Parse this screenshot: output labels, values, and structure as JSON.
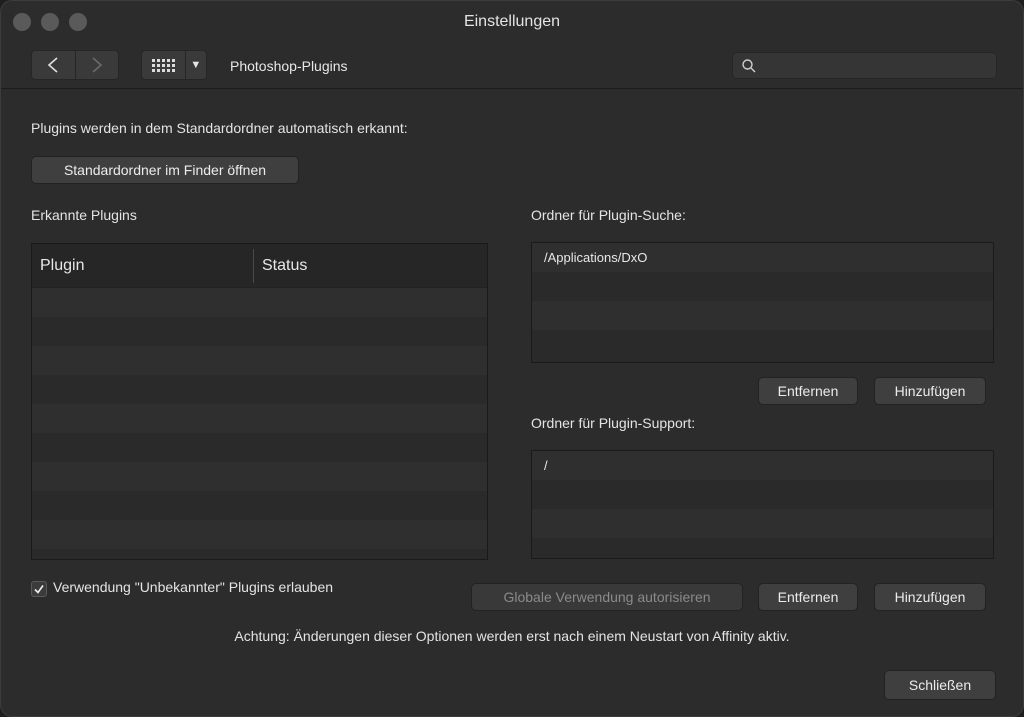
{
  "window": {
    "title": "Einstellungen"
  },
  "toolbar": {
    "back_icon": "chevron-left-icon",
    "forward_icon": "chevron-right-icon",
    "grid_icon": "grid-icon",
    "dropdown_icon": "triangle-down-icon",
    "section_name": "Photoshop-Plugins",
    "search_placeholder": ""
  },
  "intro": {
    "text": "Plugins werden in dem Standardordner automatisch erkannt:",
    "open_button": "Standardordner im Finder öffnen"
  },
  "plugins": {
    "title": "Erkannte Plugins",
    "columns": [
      "Plugin",
      "Status"
    ],
    "rows": []
  },
  "search_folders": {
    "title": "Ordner für Plugin-Suche:",
    "items": [
      "/Applications/DxO"
    ],
    "remove_button": "Entfernen",
    "add_button": "Hinzufügen"
  },
  "support_folders": {
    "title": "Ordner für Plugin-Support:",
    "items": [
      "/"
    ],
    "remove_button": "Entfernen",
    "add_button": "Hinzufügen"
  },
  "options": {
    "unknown_plugins_label": "Verwendung \"Unbekannter\" Plugins erlauben",
    "unknown_plugins_checked": true,
    "authorize_button": "Globale Verwendung autorisieren"
  },
  "notice": "Achtung: Änderungen dieser Optionen werden erst nach einem Neustart von Affinity aktiv.",
  "close_button": "Schließen",
  "colors": {
    "window_bg": "#2c2c2c",
    "button_bg": "#3f3f3f",
    "disabled_text": "#8a8a8a"
  }
}
